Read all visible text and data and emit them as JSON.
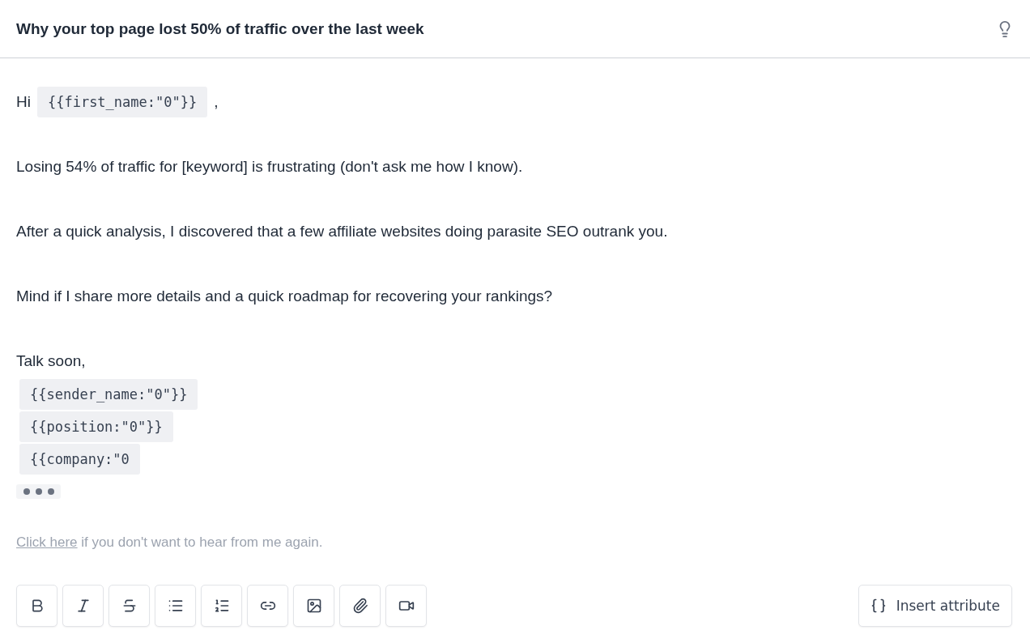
{
  "subject": "Why your top page lost 50% of traffic over the last week",
  "body": [
    {
      "kind": "greeting",
      "text": "Hi",
      "variable": "{{first_name:\"0\"}}",
      "suffix": ","
    },
    {
      "kind": "paragraph",
      "text": "Losing 54% of traffic for [keyword] is frustrating (don't ask me how I know)."
    },
    {
      "kind": "paragraph",
      "text": "After a quick analysis, I discovered that a few affiliate websites doing parasite SEO outrank you."
    },
    {
      "kind": "paragraph",
      "text": "Mind if I share more details and a quick roadmap for recovering your rankings?"
    },
    {
      "kind": "signoff",
      "text": "Talk soon,"
    },
    {
      "kind": "variable",
      "text": "{{sender_name:\"0\"}}"
    },
    {
      "kind": "variable",
      "text": "{{position:\"0\"}}"
    },
    {
      "kind": "variable",
      "text": "{{company:\"0"
    }
  ],
  "footer": {
    "link": "Click here",
    "text": "if you don't want to hear from me again."
  },
  "toolbar": [
    {
      "kind": "bold"
    },
    {
      "kind": "italic"
    },
    {
      "kind": "strikethrough"
    },
    {
      "kind": "bullet-list"
    },
    {
      "kind": "numbered-list"
    },
    {
      "kind": "link"
    },
    {
      "kind": "image"
    },
    {
      "kind": "attachment"
    },
    {
      "kind": "video"
    }
  ],
  "insert_button": {
    "label": "Insert attribute"
  }
}
